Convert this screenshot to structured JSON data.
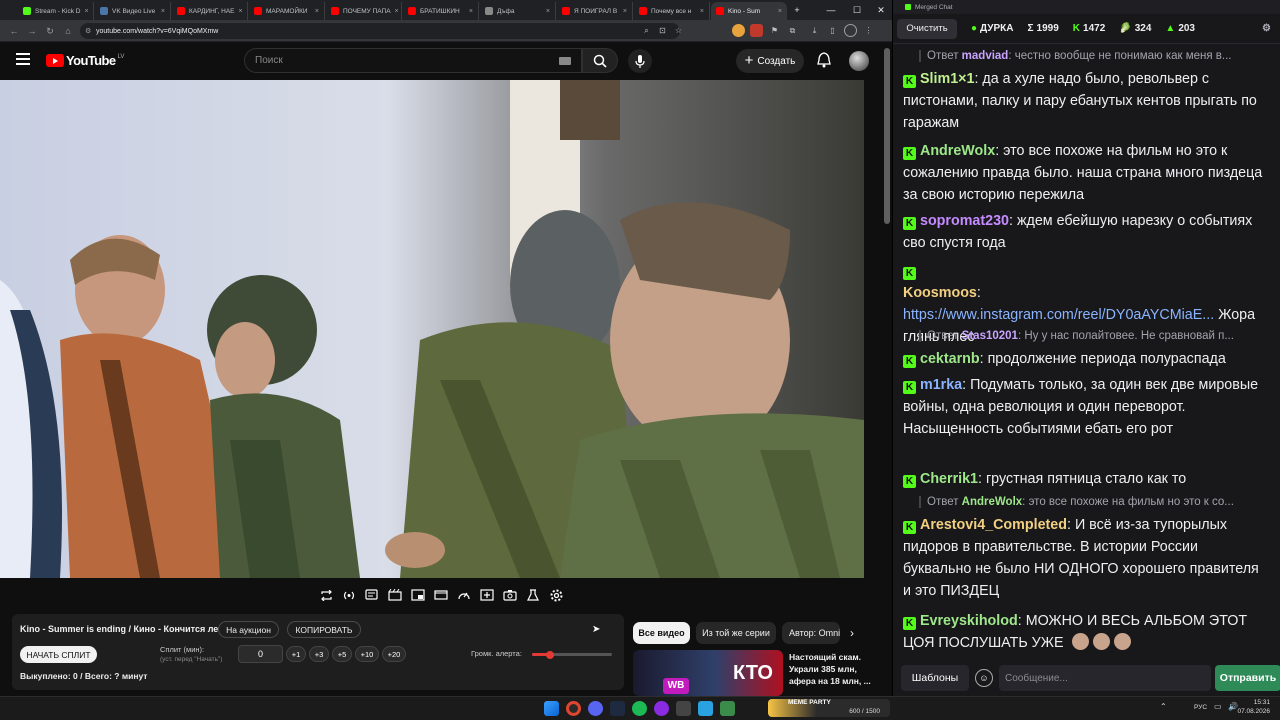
{
  "browser": {
    "tabs": [
      {
        "label": "Stream - Kick D",
        "fav": "#53fc18"
      },
      {
        "label": "VK Видео Live",
        "fav": "#4a76a8"
      },
      {
        "label": "КАРДИНГ, НАЕ",
        "fav": "#ff0000"
      },
      {
        "label": "МАРАМОЙКИ",
        "fav": "#ff0000"
      },
      {
        "label": "ПОЧЕМУ ПАПА",
        "fav": "#ff0000"
      },
      {
        "label": "БРАТИШКИН",
        "fav": "#ff0000"
      },
      {
        "label": "Дъфа",
        "fav": "#888888"
      },
      {
        "label": "Я ПОИГРАЛ В",
        "fav": "#ff0000"
      },
      {
        "label": "Почему все н",
        "fav": "#ff0000"
      },
      {
        "label": "Kino - Sum",
        "fav": "#ff0000"
      }
    ],
    "new_tab": "+",
    "url": "youtube.com/watch?v=6VqiMQoMXmw"
  },
  "youtube": {
    "logo": "YouTube",
    "country": "LV",
    "search_placeholder": "Поиск",
    "create_label": "Создать"
  },
  "auction": {
    "title": "Kino - Summer is ending / Кино - Кончится лето",
    "auction_btn": "На аукцион",
    "copy_btn": "КОПИРОВАТЬ",
    "start_split": "НАЧАТЬ СПЛИТ",
    "split_label": "Сплит (мин):",
    "split_hint": "(уст. перед \"Начать\")",
    "split_value": "0",
    "steps": [
      "+1",
      "+3",
      "+5",
      "+10",
      "+20"
    ],
    "volume_label": "Громк. алерта:",
    "volume_level": 0.22,
    "bought": "Выкуплено: 0 / Всего: ? минут"
  },
  "recommendations": {
    "chips": [
      "Все видео",
      "Из той же серии",
      "Автор: Omni"
    ],
    "video_title": "Настоящий скам. Украли 385 млн, афера на 18 млн, ...",
    "thumb_text": "КТО",
    "thumb_text2": "WB"
  },
  "chat": {
    "window_title": "Merged Chat",
    "clear": "Очистить",
    "stats": [
      {
        "icon": "●",
        "value": "ДУРКА",
        "color": "#53fc18"
      },
      {
        "icon": "Σ",
        "value": "1999",
        "color": "#efeff1"
      },
      {
        "icon": "K",
        "value": "1472",
        "color": "#53fc18"
      },
      {
        "icon": "🥬",
        "value": "324",
        "color": "#53fc18"
      },
      {
        "icon": "▲",
        "value": "203",
        "color": "#53fc18"
      }
    ],
    "messages": [
      {
        "type": "reply",
        "reply_user": "madviad",
        "reply_text": "честно вообще не понимаю как меня в..."
      },
      {
        "type": "msg",
        "user": "Slim1×1",
        "color": "#c1f08f",
        "text": "да а хуле надо было, револьвер с пистонами, палку и пару ебанутых кентов прыгать по гаражам"
      },
      {
        "type": "msg",
        "user": "AndreWolx",
        "color": "#9ee88a",
        "text": "это все похоже на фильм но это к сожалению правда было. наша страна много пиздеца за свою историю пережила"
      },
      {
        "type": "msg",
        "user": "sopromat230",
        "color": "#c68bff",
        "text": "ждем ебейшую нарезку о событиях сво спустя года"
      },
      {
        "type": "msg",
        "user": "Koosmoos",
        "color": "#f2d080",
        "link": "https://www.instagram.com/reel/DY0aAYCMiaE...",
        "text": "Жора глянь плес"
      },
      {
        "type": "reply",
        "reply_user": "Stas10201",
        "reply_text": "Ну у нас полайтовее. Не сравновай п..."
      },
      {
        "type": "msg",
        "user": "cektarnb",
        "color": "#9ee88a",
        "text": "продолжение периода полураспада"
      },
      {
        "type": "msg",
        "user": "m1rka",
        "color": "#8ab4ff",
        "text": "Подумать только, за один век две мировые войны, одна революция и один переворот. Насыщенность событиями ебать его рот"
      },
      {
        "type": "msg",
        "user": "Cherrik1",
        "color": "#9ee88a",
        "text": "грустная пятница стало как то"
      },
      {
        "type": "reply",
        "reply_user": "AndreWolx",
        "reply_text": "это все похоже на фильм но это к со..."
      },
      {
        "type": "msg",
        "user": "Arestovi4_Completed",
        "color": "#f2d080",
        "text": "И всё из-за тупорылых пидоров в правительстве. В истории России буквально не было НИ ОДНОГО хорошего правителя и это ПИЗДЕЦ"
      },
      {
        "type": "msg",
        "user": "Evreyskiholod",
        "color": "#9ee88a",
        "text": "МОЖНО И ВЕСЬ АЛЬБОМ ЭТОТ ЦОЯ ПОСЛУШАТЬ УЖЕ"
      }
    ],
    "templates": "Шаблоны",
    "input_placeholder": "Сообщение...",
    "send": "Отправить"
  },
  "taskbar": {
    "widget_label": "MEME PARTY",
    "widget_value": "600 / 1500",
    "lang": "РУС",
    "time": "15:31",
    "date": "07.08.2026"
  },
  "colors": {
    "accent_green": "#53fc18",
    "yt_red": "#ff0000",
    "send_green": "#2e8b57"
  }
}
